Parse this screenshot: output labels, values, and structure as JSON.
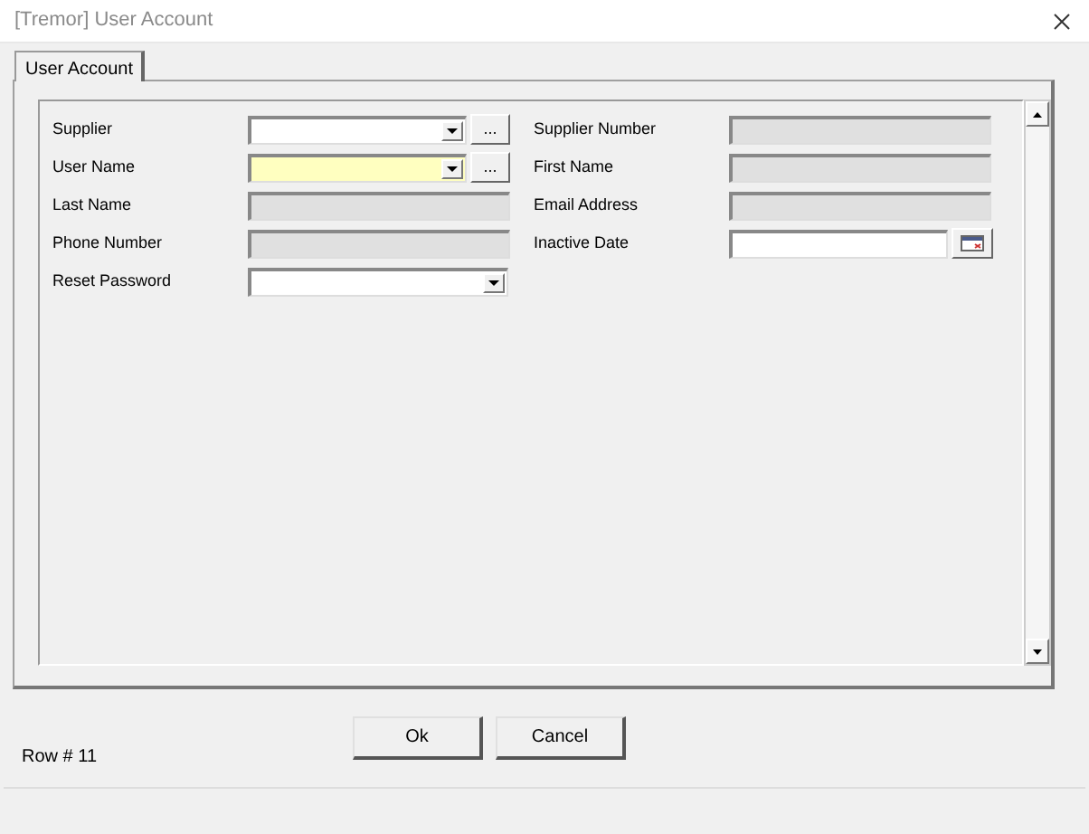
{
  "window": {
    "title": "[Tremor] User Account"
  },
  "tabs": [
    {
      "label": "User Account",
      "selected": true
    }
  ],
  "fields_left": [
    {
      "label": "Supplier",
      "kind": "combo_lookup",
      "highlighted": false,
      "button": "..."
    },
    {
      "label": "User Name",
      "kind": "combo_lookup",
      "highlighted": true,
      "button": "..."
    },
    {
      "label": "Last Name",
      "kind": "readonly",
      "highlighted": false
    },
    {
      "label": "Phone Number",
      "kind": "readonly",
      "highlighted": false
    },
    {
      "label": "Reset Password",
      "kind": "combo",
      "highlighted": false
    }
  ],
  "fields_right": [
    {
      "label": "Supplier Number",
      "kind": "readonly",
      "highlighted": false
    },
    {
      "label": "First Name",
      "kind": "readonly",
      "highlighted": false
    },
    {
      "label": "Email Address",
      "kind": "readonly",
      "highlighted": false
    },
    {
      "label": "Inactive Date",
      "kind": "date",
      "highlighted": false
    }
  ],
  "status": "Row # 11",
  "buttons": [
    "Ok",
    "Cancel"
  ]
}
